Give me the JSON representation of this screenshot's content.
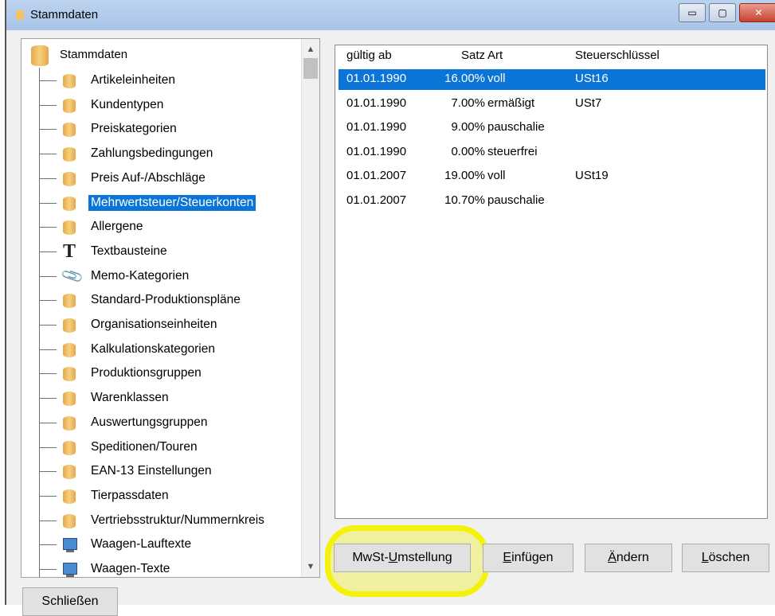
{
  "window": {
    "title": "Stammdaten"
  },
  "titlebar_buttons": {
    "minimize": "▭",
    "maximize": "▢",
    "close": "✕"
  },
  "tree": {
    "root": "Stammdaten",
    "items": [
      {
        "label": "Artikeleinheiten",
        "icon": "database-icon"
      },
      {
        "label": "Kundentypen",
        "icon": "database-icon"
      },
      {
        "label": "Preiskategorien",
        "icon": "database-icon"
      },
      {
        "label": "Zahlungsbedingungen",
        "icon": "database-icon"
      },
      {
        "label": "Preis Auf-/Abschläge",
        "icon": "database-icon"
      },
      {
        "label": "Mehrwertsteuer/Steuerkonten",
        "icon": "database-icon",
        "selected": true
      },
      {
        "label": "Allergene",
        "icon": "database-icon"
      },
      {
        "label": "Textbausteine",
        "icon": "text-t-icon"
      },
      {
        "label": "Memo-Kategorien",
        "icon": "paperclip-icon"
      },
      {
        "label": "Standard-Produktionspläne",
        "icon": "database-icon"
      },
      {
        "label": "Organisationseinheiten",
        "icon": "database-icon"
      },
      {
        "label": "Kalkulationskategorien",
        "icon": "database-icon"
      },
      {
        "label": "Produktionsgruppen",
        "icon": "database-icon"
      },
      {
        "label": "Warenklassen",
        "icon": "database-icon"
      },
      {
        "label": "Auswertungsgruppen",
        "icon": "database-icon"
      },
      {
        "label": "Speditionen/Touren",
        "icon": "database-icon"
      },
      {
        "label": "EAN-13 Einstellungen",
        "icon": "database-icon"
      },
      {
        "label": "Tierpassdaten",
        "icon": "database-icon"
      },
      {
        "label": "Vertriebsstruktur/Nummernkreis",
        "icon": "database-icon"
      },
      {
        "label": "Waagen-Lauftexte",
        "icon": "monitor-icon"
      },
      {
        "label": "Waagen-Texte",
        "icon": "monitor-icon"
      }
    ]
  },
  "table": {
    "headers": {
      "date": "gültig ab",
      "rate": "Satz",
      "art": "Art",
      "key": "Steuerschlüssel"
    },
    "rows": [
      {
        "date": "01.01.1990",
        "rate": "16.00%",
        "art": "voll",
        "key": "USt16",
        "selected": true
      },
      {
        "date": "01.01.1990",
        "rate": "7.00%",
        "art": "ermäßigt",
        "key": "USt7"
      },
      {
        "date": "01.01.1990",
        "rate": "9.00%",
        "art": "pauschalie",
        "key": ""
      },
      {
        "date": "01.01.1990",
        "rate": "0.00%",
        "art": "steuerfrei",
        "key": ""
      },
      {
        "date": "01.01.2007",
        "rate": "19.00%",
        "art": "voll",
        "key": "USt19"
      },
      {
        "date": "01.01.2007",
        "rate": "10.70%",
        "art": "pauschalie",
        "key": ""
      }
    ]
  },
  "buttons": {
    "mwst_pre": "MwSt-",
    "mwst_ul": "U",
    "mwst_post": "mstellung",
    "insert_ul": "E",
    "insert_post": "infügen",
    "change_ul": "Ä",
    "change_post": "ndern",
    "delete_ul": "L",
    "delete_post": "öschen",
    "close": "Schließen"
  },
  "colors": {
    "selection": "#0a74d7",
    "highlight": "#f4f20b",
    "db_icon": "#f2c267"
  }
}
